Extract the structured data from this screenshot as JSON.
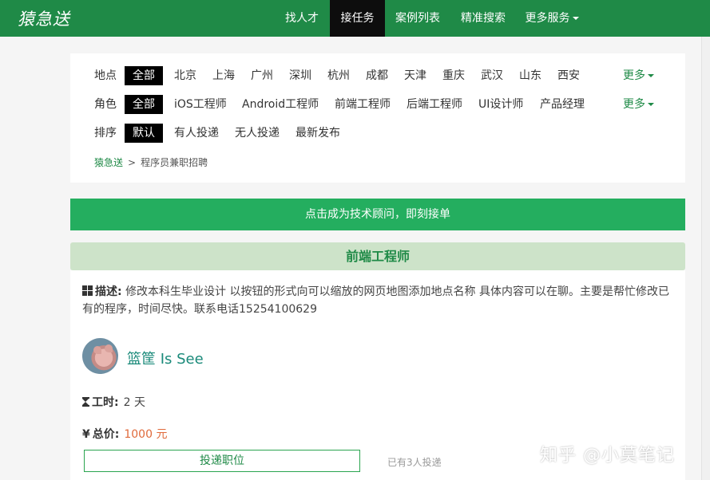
{
  "header": {
    "logo": "猿急送",
    "nav": [
      {
        "label": "找人才"
      },
      {
        "label": "接任务",
        "active": true
      },
      {
        "label": "案例列表"
      },
      {
        "label": "精准搜索"
      },
      {
        "label": "更多服务"
      }
    ],
    "brand_color": "#1f8a47"
  },
  "filters": {
    "location": {
      "label": "地点",
      "options": [
        "全部",
        "北京",
        "上海",
        "广州",
        "深圳",
        "杭州",
        "成都",
        "天津",
        "重庆",
        "武汉",
        "山东",
        "西安"
      ],
      "selected": "全部",
      "more": "更多"
    },
    "role": {
      "label": "角色",
      "options": [
        "全部",
        "iOS工程师",
        "Android工程师",
        "前端工程师",
        "后端工程师",
        "UI设计师",
        "产品经理"
      ],
      "selected": "全部",
      "more": "更多"
    },
    "sort": {
      "label": "排序",
      "options": [
        "默认",
        "有人投递",
        "无人投递",
        "最新发布"
      ],
      "selected": "默认"
    }
  },
  "breadcrumb": {
    "home": "猿急送",
    "separator": ">",
    "current": "程序员兼职招聘"
  },
  "banner": {
    "text": "点击成为技术顾问，即刻接单",
    "color": "#24ae5f"
  },
  "job": {
    "title": "前端工程师",
    "description_label": "描述:",
    "description": "修改本科生毕业设计 以按钮的形式向可以缩放的网页地图添加地点名称 具体内容可以在聊。主要是帮忙修改已有的程序，时间尽快。联系电话15254100629",
    "poster_name": "篮筐 Is See",
    "duration_label": "工时:",
    "duration_value": "2 天",
    "price_label": "总价:",
    "price_value": "1000 元",
    "price_color": "#e06a3b",
    "apply_button": "投递职位",
    "applied_count": "已有3人投递"
  },
  "watermark": "知乎 @小莫笔记"
}
